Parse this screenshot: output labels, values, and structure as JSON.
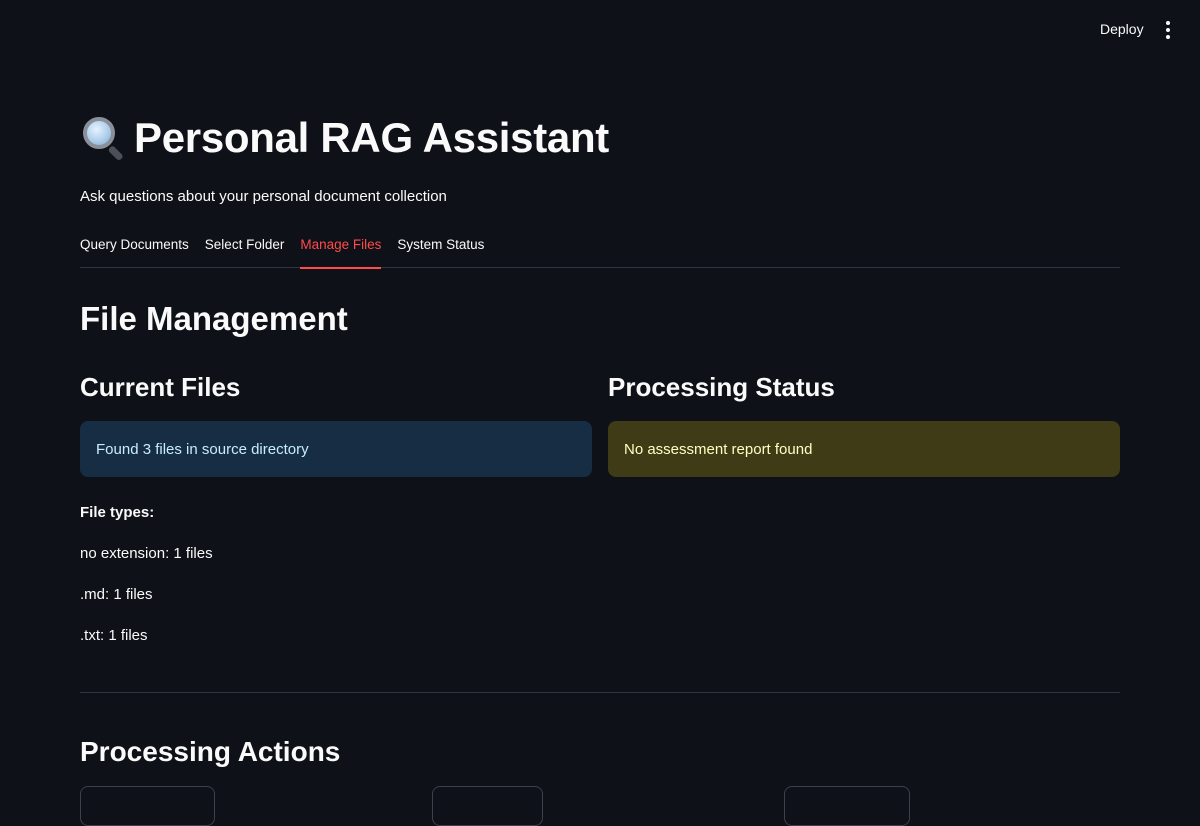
{
  "header": {
    "deploy_label": "Deploy"
  },
  "app": {
    "title": "Personal RAG Assistant",
    "title_icon": "search-icon",
    "subtitle": "Ask questions about your personal document collection"
  },
  "tabs": [
    {
      "label": "Query Documents",
      "active": false
    },
    {
      "label": "Select Folder",
      "active": false
    },
    {
      "label": "Manage Files",
      "active": true
    },
    {
      "label": "System Status",
      "active": false
    }
  ],
  "page": {
    "title": "File Management",
    "current_files": {
      "title": "Current Files",
      "info_message": "Found 3 files in source directory",
      "file_types_label": "File types:",
      "file_types": [
        "no extension: 1 files",
        ".md: 1 files",
        ".txt: 1 files"
      ]
    },
    "processing_status": {
      "title": "Processing Status",
      "warning_message": "No assessment report found"
    },
    "processing_actions": {
      "title": "Processing Actions"
    }
  },
  "colors": {
    "background": "#0e1117",
    "accent": "#ff4b4b",
    "info_bg": "#172d43",
    "warning_bg": "#3e3b16"
  }
}
